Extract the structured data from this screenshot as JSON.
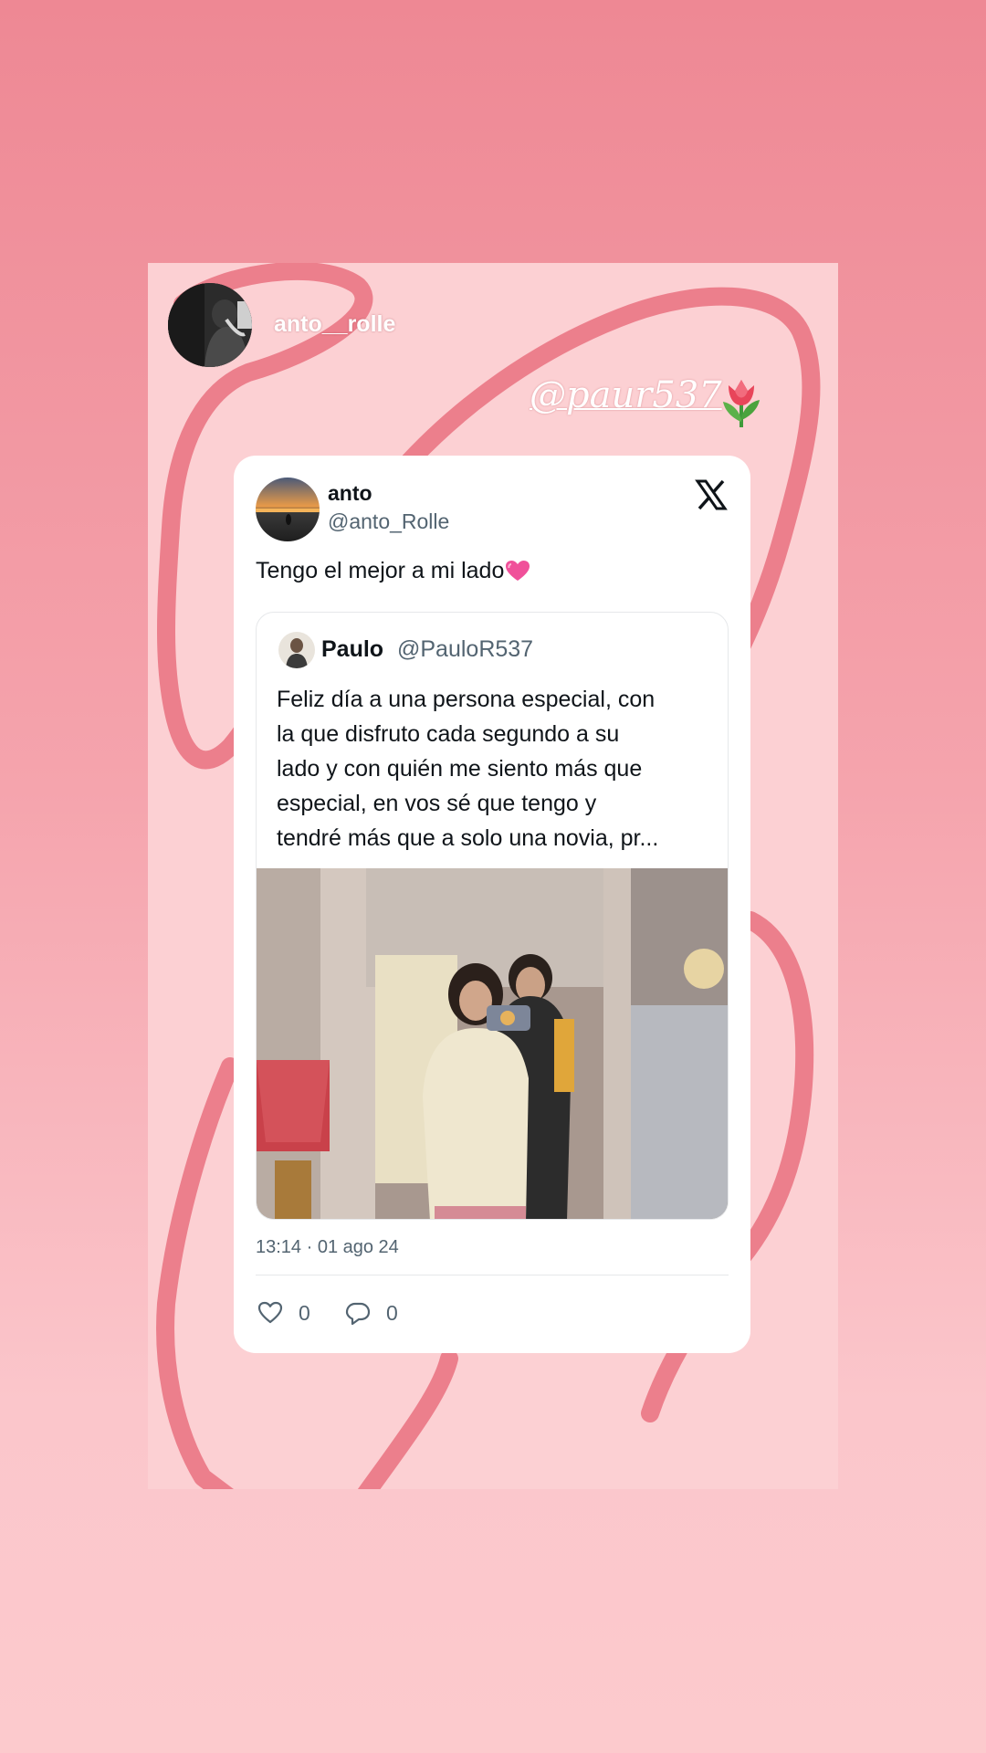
{
  "story": {
    "username": "anto__rolle",
    "mention": "@paur537",
    "sticker": "tulip-emoji",
    "colors": {
      "background_top": "#ee8894",
      "background_bottom": "#fccacd",
      "scribble": "#ec7f8c"
    }
  },
  "tweet": {
    "author_name": "anto",
    "author_handle": "@anto_Rolle",
    "text": "Tengo el mejor a mi lado",
    "emoji": "pink-heart-emoji",
    "platform_icon": "x-logo-icon",
    "quote": {
      "name": "Paulo",
      "handle": "@PauloR537",
      "lines": [
        "Feliz día a una persona especial, con",
        "la que disfruto cada segundo a su",
        "lado y con quién me siento más que",
        "especial, en vos sé que tengo y",
        "tendré más que a solo una novia, pr..."
      ]
    },
    "timestamp": "13:14 · 01 ago 24",
    "likes": "0",
    "replies": "0"
  }
}
